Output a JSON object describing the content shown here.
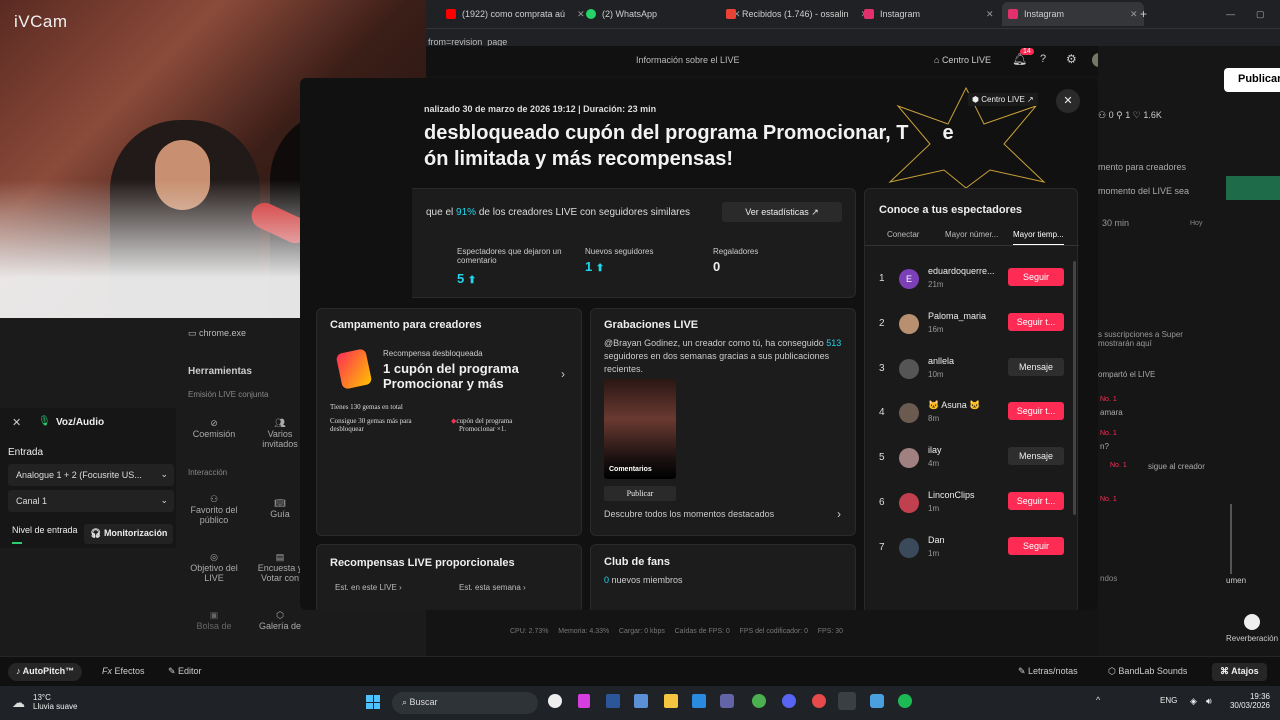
{
  "webcam": {
    "app_label": "iVCam"
  },
  "browser": {
    "tabs": [
      {
        "label": "(1922) como comprata aú",
        "color": "#ff0000"
      },
      {
        "label": "(2) WhatsApp",
        "color": "#25d366"
      },
      {
        "label": "Recibidos (1.746) - ossalin",
        "color": "#ea4335"
      },
      {
        "label": "Instagram",
        "color": "#e1306c"
      },
      {
        "label": "Instagram",
        "color": "#e1306c"
      }
    ],
    "new_tab": "+",
    "url": "from=revision_page"
  },
  "studio_header": {
    "title": "Información sobre el LIVE",
    "centro_live": "Centro LIVE",
    "notif_count": "14",
    "publicar": "Publicar",
    "stats": [
      "0",
      "1",
      "1.6K"
    ]
  },
  "modal": {
    "meta_prefix": "nalizado",
    "meta_date": "30 de marzo de 2026 19:12 | Duración: 23 min",
    "headline_line1": "desbloqueado cupón del programa Promocionar, T",
    "headline_line1_end": "e",
    "headline_line2": "ón limitada y más recompensas!",
    "centro_live_chip": "Centro LIVE ↗",
    "close": "✕",
    "stats_text_a": "que el ",
    "stats_pct": "91%",
    "stats_text_b": " de los creadores LIVE con seguidores similares",
    "ver_stats": "Ver estadísticas ↗",
    "metrics": [
      {
        "label": "Espectadores que dejaron un comentario",
        "value": "5"
      },
      {
        "label": "Nuevos seguidores",
        "value": "1"
      },
      {
        "label": "Regaladores",
        "value": "0"
      }
    ],
    "camp": {
      "title": "Campamento para creadores",
      "reward_label": "Recompensa desbloqueada",
      "reward_title_1": "1 cupón del programa",
      "reward_title_2": "Promocionar y más",
      "gems_line": "Tienes 130 gemas en total",
      "gems_need_1": "Consigue 30 gemas más para",
      "gems_need_2": "desbloquear",
      "coupon_1": "cupón del programa",
      "coupon_2": "Promocionar ×1."
    },
    "recordings": {
      "title": "Grabaciones LIVE",
      "desc_a": "@Brayan Godinez, un creador como tú, ha conseguido",
      "desc_num": "513",
      "desc_b": " seguidores en dos semanas gracias a sus",
      "desc_c": "publicaciones recientes.",
      "thumb_label": "Comentarios",
      "publicar": "Publicar",
      "footer": "Descubre todos los momentos destacados"
    },
    "rewards": {
      "title": "Recompensas LIVE proporcionales",
      "est_live": "Est. en este LIVE ›",
      "est_week": "Est. esta semana ›"
    },
    "fans": {
      "title": "Club de fans",
      "count": "0",
      "label": " nuevos miembros"
    },
    "viewers": {
      "title": "Conoce a tus espectadores",
      "tabs": [
        "Conectar",
        "Mayor númer...",
        "Mayor tiemp..."
      ],
      "rows": [
        {
          "rank": "1",
          "name": "eduardoquerre...",
          "time": "21m",
          "action": "Seguir",
          "type": "pink",
          "avatar": "#7b3fb8",
          "initial": "E"
        },
        {
          "rank": "2",
          "name": "Paloma_maria",
          "time": "16m",
          "action": "Seguir t...",
          "type": "pink",
          "avatar": "#b89070",
          "initial": ""
        },
        {
          "rank": "3",
          "name": "anllela",
          "time": "10m",
          "action": "Mensaje",
          "type": "gray",
          "avatar": "#555",
          "initial": ""
        },
        {
          "rank": "4",
          "name": "🐱 Asuna 🐱",
          "time": "8m",
          "action": "Seguir t...",
          "type": "pink",
          "avatar": "#6a5a50",
          "initial": ""
        },
        {
          "rank": "5",
          "name": "ilay",
          "time": "4m",
          "action": "Mensaje",
          "type": "gray",
          "avatar": "#a08080",
          "initial": ""
        },
        {
          "rank": "6",
          "name": "LinconClips",
          "time": "1m",
          "action": "Seguir t...",
          "type": "pink",
          "avatar": "#c04050",
          "initial": ""
        },
        {
          "rank": "7",
          "name": "Dan",
          "time": "1m",
          "action": "Seguir",
          "type": "pink",
          "avatar": "#3a4a5a",
          "initial": ""
        }
      ]
    }
  },
  "left_panel": {
    "source": "chrome.exe",
    "tools_title": "Herramientas",
    "emision": "Emisión LIVE conjunta",
    "coemision": "Coemisión",
    "varios": "Varios invitados",
    "interaccion": "Interacción",
    "favorito": "Favorito del público",
    "guia": "Guía",
    "objetivo": "Objetivo del LIVE",
    "encuesta": "Encuesta y Votar con",
    "bolsa": "Bolsa de",
    "galeria": "Galería de"
  },
  "audio_panel": {
    "title": "Voz/Audio",
    "entrada": "Entrada",
    "device": "Analogue 1 + 2 (Focusrite US...",
    "canal": "Canal 1",
    "nivel": "Nivel de entrada",
    "monitor": "Monitorización"
  },
  "right_panel": {
    "campamento": "mento para creadores",
    "momento": "momento del LIVE sea",
    "min30": "30 min",
    "hoy": "Hoy",
    "susc_1": "s suscripciones a Super",
    "susc_2": "mostrarán aquí",
    "compartio": "ompartó el LIVE",
    "badge": "No. 1",
    "amara": "amara",
    "n": "n?",
    "sigue": "sigue al creador",
    "ndos": "ndos",
    "umen": "umen",
    "reverb": "Reverberación"
  },
  "status_bar": "CPU: 2.73%     Memoria: 4.33%     Cargar: 0 kbps     Caídas de FPS: 0     FPS del codificador: 0     FPS: 30",
  "bottom_bar": {
    "autopitch": "AutoPitch™",
    "efectos": "Efectos",
    "editor": "Editor",
    "letras": "Letras/notas",
    "bandlab": "BandLab Sounds",
    "atajos": "Atajos"
  },
  "taskbar": {
    "temp": "13°C",
    "weather": "Lluvia suave",
    "search": "Buscar",
    "lang": "ENG",
    "time": "19:36",
    "date": "30/03/2026"
  }
}
